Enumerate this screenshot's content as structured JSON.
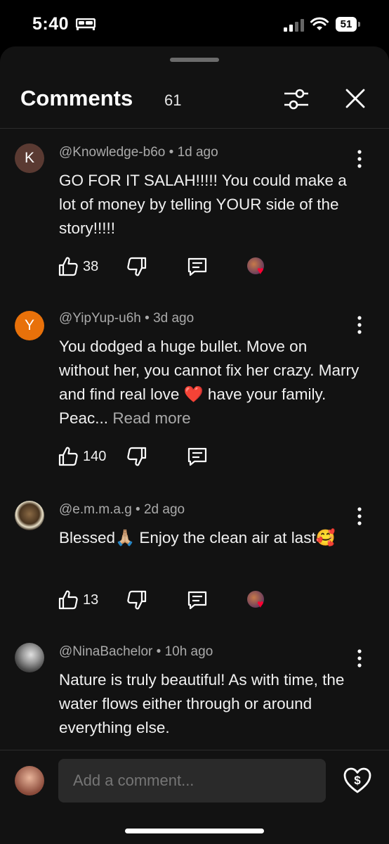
{
  "status": {
    "time": "5:40",
    "battery": "51"
  },
  "header": {
    "title": "Comments",
    "count": "61"
  },
  "colors": {
    "background": "#121212",
    "accent_heart": "#ff0033",
    "avatar_k": "#5a3a32",
    "avatar_y": "#e8710a"
  },
  "comments": [
    {
      "author": "@Knowledge-b6o",
      "age": "1d ago",
      "avatar_letter": "K",
      "text": "GO FOR IT SALAH!!!!!  You could make a lot of money by telling YOUR side of the story!!!!!",
      "read_more": "",
      "likes": "38",
      "creator_heart": true
    },
    {
      "author": "@YipYup-u6h",
      "age": "3d ago",
      "avatar_letter": "Y",
      "text": "You dodged a huge bullet. Move on without her, you cannot fix her crazy. Marry and find real love ❤️ have your family.  Peac...",
      "read_more": "Read more",
      "likes": "140",
      "creator_heart": false
    },
    {
      "author": "@e.m.m.a.g",
      "age": "2d ago",
      "avatar_letter": "",
      "text": "Blessed🙏🏼 Enjoy the clean air at last🥰",
      "read_more": "",
      "likes": "13",
      "creator_heart": true
    },
    {
      "author": "@NinaBachelor",
      "age": "10h ago",
      "avatar_letter": "",
      "text": "Nature is truly beautiful! As with time, the water flows either through or around everything else.",
      "read_more": "",
      "likes": "",
      "creator_heart": false
    }
  ],
  "composer": {
    "placeholder": "Add a comment..."
  },
  "icons": {
    "filter": "sliders-icon",
    "close": "close-icon",
    "more": "more-vert-icon",
    "like": "thumbs-up-icon",
    "dislike": "thumbs-down-icon",
    "reply": "reply-icon",
    "thanks": "heart-dollar-icon",
    "sleep": "bed-icon",
    "signal": "signal-icon",
    "wifi": "wifi-icon"
  }
}
